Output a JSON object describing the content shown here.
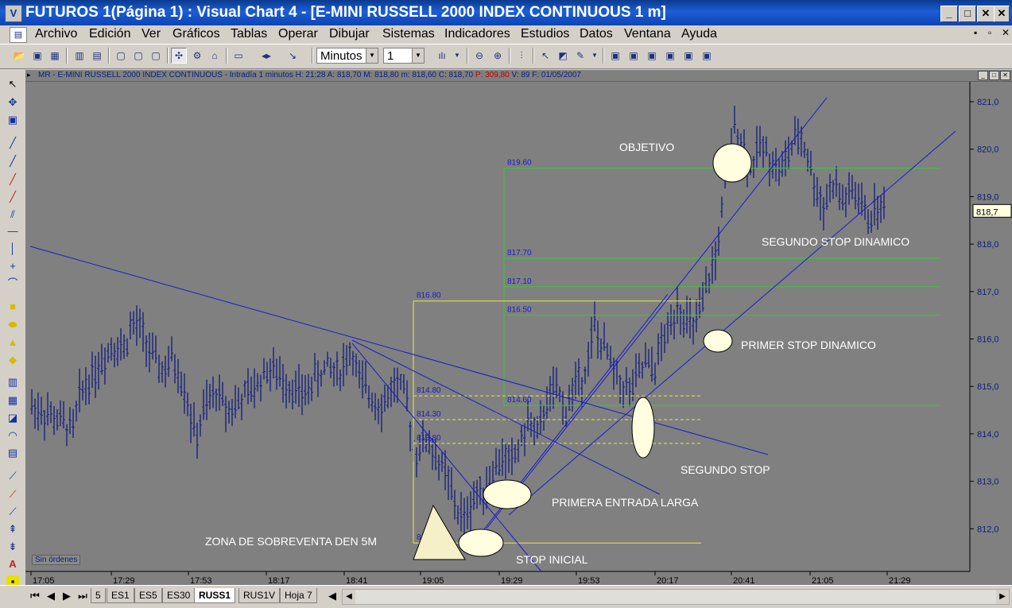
{
  "window": {
    "title": "FUTUROS 1(Página 1) : Visual Chart 4 - [E-MINI RUSSELL 2000 INDEX CONTINUOUS 1 m]",
    "btn_min": "_",
    "btn_max": "□",
    "btn_close": "✕"
  },
  "menu": [
    "Archivo",
    "Edición",
    "Ver",
    "Gráficos",
    "Tablas",
    "Operar",
    "Dibujar",
    "Sistemas",
    "Indicadores",
    "Estudios",
    "Datos",
    "Ventana",
    "Ayuda"
  ],
  "toolbar": {
    "period": "Minutos",
    "period_value": "1"
  },
  "chart": {
    "header_main": "MR - E-MINI RUSSELL 2000 INDEX CONTINUOUS - Intradía 1 minutos  H: 21:28  A: 818,70  M: 818,80  m: 818,60  C: 818,70  ",
    "header_p": "P: 309,80",
    "header_tail": "  V: 89  F: 01/05/2007",
    "current_price": "818,7",
    "sin_ordenes": "Sin órdenes",
    "annotations": [
      "OBJETIVO",
      "SEGUNDO STOP DINAMICO",
      "PRIMER STOP DINAMICO",
      "SEGUNDO STOP",
      "PRIMERA ENTRADA LARGA",
      "ZONA DE SOBREVENTA  DEN 5M",
      "STOP INICIAL"
    ],
    "level_labels": [
      "819.60",
      "817.70",
      "817.10",
      "816.50",
      "816.80",
      "814.80",
      "814.30",
      "813.80",
      "814.60",
      "811.70"
    ]
  },
  "chart_data": {
    "type": "ohlc",
    "title": "E-MINI RUSSELL 2000 INDEX CONTINUOUS 1 m",
    "y_ticks": [
      "821,0",
      "820,0",
      "819,0",
      "818,0",
      "817,0",
      "816,0",
      "815,0",
      "814,0",
      "813,0",
      "812,0"
    ],
    "ylim": [
      811.3,
      821.3
    ],
    "x_ticks": [
      "17:05",
      "17:29",
      "17:53",
      "18:17",
      "18:41",
      "19:05",
      "19:29",
      "19:53",
      "20:17",
      "20:41",
      "21:05",
      "21:29"
    ],
    "grid": false,
    "colors": {
      "bars": "#1a237e",
      "background": "#808080",
      "trendlines": "#1a1acc",
      "green_levels": "#33cc33",
      "yellow_levels": "#e8e84a",
      "ellipse": "#ffffe0"
    }
  },
  "tabs": [
    "5",
    "ES1",
    "ES5",
    "ES30",
    "RUSS1",
    "RUS1V",
    "Hoja 7"
  ],
  "active_tab": "RUSS1"
}
